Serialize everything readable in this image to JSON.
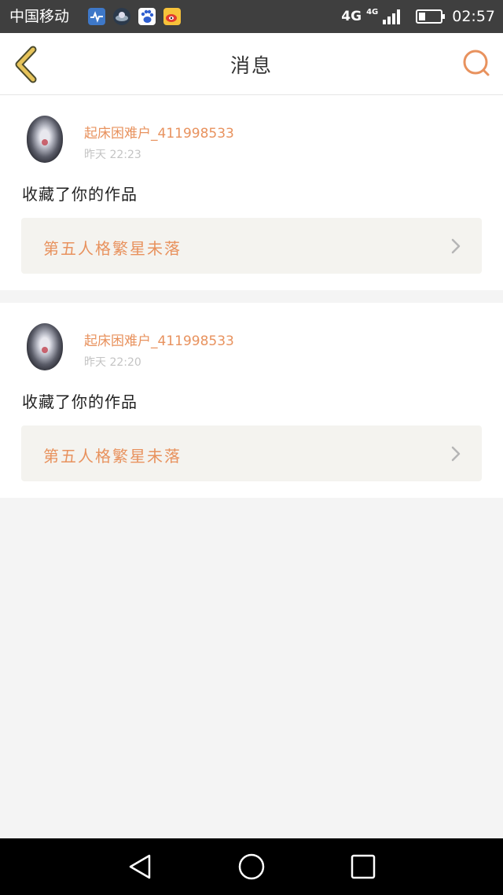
{
  "status_bar": {
    "carrier": "中国移动",
    "app_icons": [
      "health-app-icon",
      "weather-app-icon",
      "baidu-app-icon",
      "weibo-app-icon"
    ],
    "network": "4G",
    "network_secondary": "4G",
    "battery_level": 0.3,
    "time": "02:57"
  },
  "header": {
    "title": "消息",
    "back_icon": "chevron-left-icon",
    "search_icon": "search-icon"
  },
  "messages": [
    {
      "username": "起床困难户_411998533",
      "time": "昨天 22:23",
      "action": "收藏了你的作品",
      "work_title": "第五人格繁星未落"
    },
    {
      "username": "起床困难户_411998533",
      "time": "昨天 22:20",
      "action": "收藏了你的作品",
      "work_title": "第五人格繁星未落"
    }
  ],
  "colors": {
    "accent": "#e8925e",
    "back_icon": "#e6c35a",
    "status_bar_bg": "#3f3f3f",
    "card_bg": "#ffffff",
    "work_bg": "#f4f3ef",
    "page_bg": "#f4f4f4"
  },
  "nav_bar": {
    "icons": [
      "nav-back-icon",
      "nav-home-icon",
      "nav-recent-icon"
    ]
  }
}
